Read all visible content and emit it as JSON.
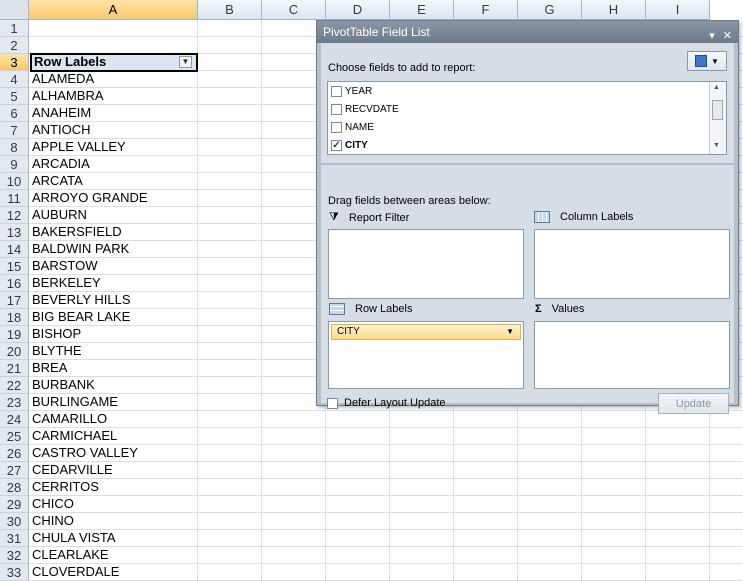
{
  "sheet": {
    "columns": [
      "A",
      "B",
      "C",
      "D",
      "E",
      "F",
      "G",
      "H",
      "I"
    ],
    "selected_column": "A",
    "header_cell": "Row Labels",
    "rows": [
      {
        "n": "1",
        "v": ""
      },
      {
        "n": "2",
        "v": ""
      },
      {
        "n": "3",
        "v": "Row Labels"
      },
      {
        "n": "4",
        "v": "ALAMEDA"
      },
      {
        "n": "5",
        "v": "ALHAMBRA"
      },
      {
        "n": "6",
        "v": "ANAHEIM"
      },
      {
        "n": "7",
        "v": "ANTIOCH"
      },
      {
        "n": "8",
        "v": "APPLE VALLEY"
      },
      {
        "n": "9",
        "v": "ARCADIA"
      },
      {
        "n": "10",
        "v": "ARCATA"
      },
      {
        "n": "11",
        "v": "ARROYO GRANDE"
      },
      {
        "n": "12",
        "v": "AUBURN"
      },
      {
        "n": "13",
        "v": "BAKERSFIELD"
      },
      {
        "n": "14",
        "v": "BALDWIN PARK"
      },
      {
        "n": "15",
        "v": "BARSTOW"
      },
      {
        "n": "16",
        "v": "BERKELEY"
      },
      {
        "n": "17",
        "v": "BEVERLY HILLS"
      },
      {
        "n": "18",
        "v": "BIG BEAR LAKE"
      },
      {
        "n": "19",
        "v": "BISHOP"
      },
      {
        "n": "20",
        "v": "BLYTHE"
      },
      {
        "n": "21",
        "v": "BREA"
      },
      {
        "n": "22",
        "v": "BURBANK"
      },
      {
        "n": "23",
        "v": "BURLINGAME"
      },
      {
        "n": "24",
        "v": "CAMARILLO"
      },
      {
        "n": "25",
        "v": "CARMICHAEL"
      },
      {
        "n": "26",
        "v": "CASTRO VALLEY"
      },
      {
        "n": "27",
        "v": "CEDARVILLE"
      },
      {
        "n": "28",
        "v": "CERRITOS"
      },
      {
        "n": "29",
        "v": "CHICO"
      },
      {
        "n": "30",
        "v": "CHINO"
      },
      {
        "n": "31",
        "v": "CHULA VISTA"
      },
      {
        "n": "32",
        "v": "CLEARLAKE"
      },
      {
        "n": "33",
        "v": "CLOVERDALE"
      }
    ]
  },
  "pivot": {
    "title": "PivotTable Field List",
    "choose_label": "Choose fields to add to report:",
    "fields": [
      {
        "name": "YEAR",
        "checked": false
      },
      {
        "name": "RECVDATE",
        "checked": false
      },
      {
        "name": "NAME",
        "checked": false
      },
      {
        "name": "CITY",
        "checked": true
      }
    ],
    "drag_label": "Drag fields between areas below:",
    "report_filter": "Report Filter",
    "column_labels": "Column Labels",
    "row_labels": "Row Labels",
    "values": "Values",
    "row_field": "CITY",
    "defer_label": "Defer Layout Update",
    "update_label": "Update"
  }
}
